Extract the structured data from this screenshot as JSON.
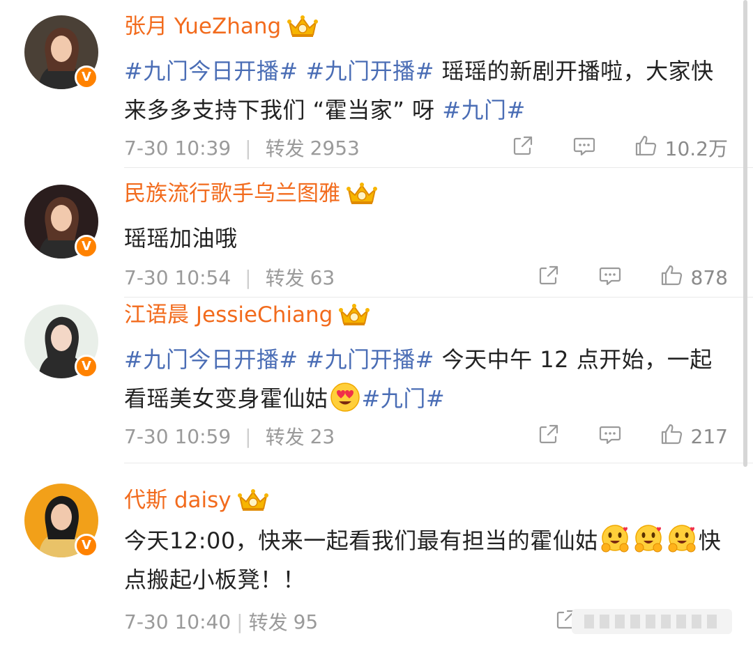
{
  "posts": [
    {
      "name": "张月 YueZhang",
      "segments": [
        {
          "t": "#九门今日开播#",
          "tag": true
        },
        {
          "t": " ",
          "tag": false
        },
        {
          "t": "#九门开播#",
          "tag": true
        },
        {
          "t": " 瑶瑶的新剧开播啦，大家快来多多支持下我们 “霍当家” 呀 ",
          "tag": false
        },
        {
          "t": "#九门#",
          "tag": true
        }
      ],
      "time": "7-30 10:39",
      "repost_label": "转发",
      "repost_count": "2953",
      "likes": "10.2万",
      "avatar_color": "#4a4036"
    },
    {
      "name": "民族流行歌手乌兰图雅",
      "segments": [
        {
          "t": "瑶瑶加油哦",
          "tag": false
        }
      ],
      "time": "7-30 10:54",
      "repost_label": "转发",
      "repost_count": "63",
      "likes": "878",
      "avatar_color": "#2a1d1d"
    },
    {
      "name": "江语晨 JessieChiang",
      "segments": [
        {
          "t": "#九门今日开播#",
          "tag": true
        },
        {
          "t": " ",
          "tag": false
        },
        {
          "t": "#九门开播#",
          "tag": true
        },
        {
          "t": " 今天中午 12 点开始，一起看瑶美女变身霍仙姑",
          "tag": false
        },
        {
          "t": "",
          "emoji": "heart-eyes"
        },
        {
          "t": "#九门#",
          "tag": true
        }
      ],
      "time": "7-30 10:59",
      "repost_label": "转发",
      "repost_count": "23",
      "likes": "217",
      "avatar_color": "#e9efe9"
    },
    {
      "name": "代斯 daisy",
      "segments": [
        {
          "t": "今天12:00，快来一起看我们最有担当的霍仙姑",
          "tag": false
        },
        {
          "t": "",
          "emoji": "hug"
        },
        {
          "t": "",
          "emoji": "hug"
        },
        {
          "t": "",
          "emoji": "hug"
        },
        {
          "t": "快点搬起小板凳！！",
          "tag": false
        }
      ],
      "time": "7-30 10:40",
      "repost_label": "转发",
      "repost_count": "95",
      "likes": "",
      "avatar_color": "#f2a019"
    }
  ],
  "colors": {
    "username": "#f26b1d",
    "hashtag": "#4a6db5",
    "meta": "#9a9a9a",
    "verified": "#ff8200"
  },
  "icons": [
    "share-icon",
    "comment-icon",
    "like-icon",
    "verified-badge-icon",
    "crown-icon"
  ],
  "verified_letter": "V"
}
